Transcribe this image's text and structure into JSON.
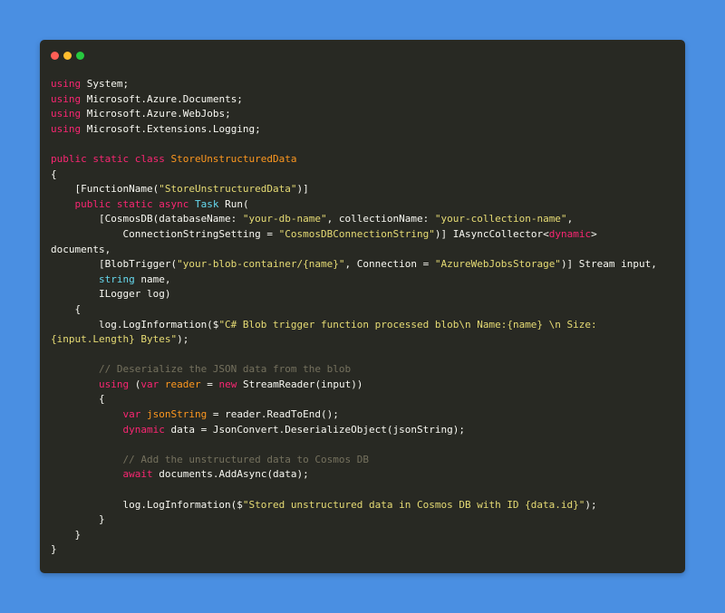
{
  "theme": {
    "background": "#4a8fe2",
    "window": "#282923",
    "dots": [
      "#ff5f56",
      "#ffbd2e",
      "#27c93f"
    ],
    "keyword": "#f92672",
    "string": "#e6db74",
    "type": "#66d9ef",
    "class": "#fd971f",
    "comment": "#75715e",
    "plain": "#f8f8f2"
  },
  "window_controls": [
    "close",
    "minimize",
    "maximize"
  ],
  "code_lines": [
    [
      [
        "kw",
        "using"
      ],
      [
        "pl",
        " System;"
      ]
    ],
    [
      [
        "kw",
        "using"
      ],
      [
        "pl",
        " Microsoft.Azure.Documents;"
      ]
    ],
    [
      [
        "kw",
        "using"
      ],
      [
        "pl",
        " Microsoft.Azure.WebJobs;"
      ]
    ],
    [
      [
        "kw",
        "using"
      ],
      [
        "pl",
        " Microsoft.Extensions.Logging;"
      ]
    ],
    [],
    [
      [
        "kw",
        "public static class "
      ],
      [
        "cls",
        "StoreUnstructuredData"
      ]
    ],
    [
      [
        "pl",
        "{"
      ]
    ],
    [
      [
        "pl",
        "    [FunctionName("
      ],
      [
        "str",
        "\"StoreUnstructuredData\""
      ],
      [
        "pl",
        ")]"
      ]
    ],
    [
      [
        "pl",
        "    "
      ],
      [
        "kw",
        "public static async "
      ],
      [
        "type",
        "Task"
      ],
      [
        "pl",
        " Run("
      ]
    ],
    [
      [
        "pl",
        "        [CosmosDB(databaseName: "
      ],
      [
        "str",
        "\"your-db-name\""
      ],
      [
        "pl",
        ", collectionName: "
      ],
      [
        "str",
        "\"your-collection-name\""
      ],
      [
        "pl",
        ","
      ]
    ],
    [
      [
        "pl",
        "            ConnectionStringSetting = "
      ],
      [
        "str",
        "\"CosmosDBConnectionString\""
      ],
      [
        "pl",
        ")] IAsyncCollector<"
      ],
      [
        "kw",
        "dynamic"
      ],
      [
        "pl",
        ">"
      ]
    ],
    [
      [
        "pl",
        "documents,"
      ]
    ],
    [
      [
        "pl",
        "        [BlobTrigger("
      ],
      [
        "str",
        "\"your-blob-container/{name}\""
      ],
      [
        "pl",
        ", Connection = "
      ],
      [
        "str",
        "\"AzureWebJobsStorage\""
      ],
      [
        "pl",
        ")] Stream input,"
      ]
    ],
    [
      [
        "pl",
        "        "
      ],
      [
        "type",
        "string"
      ],
      [
        "pl",
        " name,"
      ]
    ],
    [
      [
        "pl",
        "        ILogger log)"
      ]
    ],
    [
      [
        "pl",
        "    {"
      ]
    ],
    [
      [
        "pl",
        "        log.LogInformation($"
      ],
      [
        "str",
        "\"C# Blob trigger function processed blob\\n Name:{name} \\n Size:"
      ]
    ],
    [
      [
        "str",
        "{input.Length} Bytes\""
      ],
      [
        "pl",
        ");"
      ]
    ],
    [],
    [
      [
        "cmt",
        "        // Deserialize the JSON data from the blob"
      ]
    ],
    [
      [
        "pl",
        "        "
      ],
      [
        "kw",
        "using"
      ],
      [
        "pl",
        " ("
      ],
      [
        "kw",
        "var"
      ],
      [
        "pl",
        " "
      ],
      [
        "cls",
        "reader"
      ],
      [
        "pl",
        " = "
      ],
      [
        "kw",
        "new"
      ],
      [
        "pl",
        " StreamReader(input))"
      ]
    ],
    [
      [
        "pl",
        "        {"
      ]
    ],
    [
      [
        "pl",
        "            "
      ],
      [
        "kw",
        "var"
      ],
      [
        "pl",
        " "
      ],
      [
        "cls",
        "jsonString"
      ],
      [
        "pl",
        " = reader.ReadToEnd();"
      ]
    ],
    [
      [
        "pl",
        "            "
      ],
      [
        "kw",
        "dynamic"
      ],
      [
        "pl",
        " data = JsonConvert.DeserializeObject(jsonString);"
      ]
    ],
    [],
    [
      [
        "cmt",
        "            // Add the unstructured data to Cosmos DB"
      ]
    ],
    [
      [
        "pl",
        "            "
      ],
      [
        "kw",
        "await"
      ],
      [
        "pl",
        " documents.AddAsync(data);"
      ]
    ],
    [],
    [
      [
        "pl",
        "            log.LogInformation($"
      ],
      [
        "str",
        "\"Stored unstructured data in Cosmos DB with ID {data.id}\""
      ],
      [
        "pl",
        ");"
      ]
    ],
    [
      [
        "pl",
        "        }"
      ]
    ],
    [
      [
        "pl",
        "    }"
      ]
    ],
    [
      [
        "pl",
        "}"
      ]
    ]
  ]
}
